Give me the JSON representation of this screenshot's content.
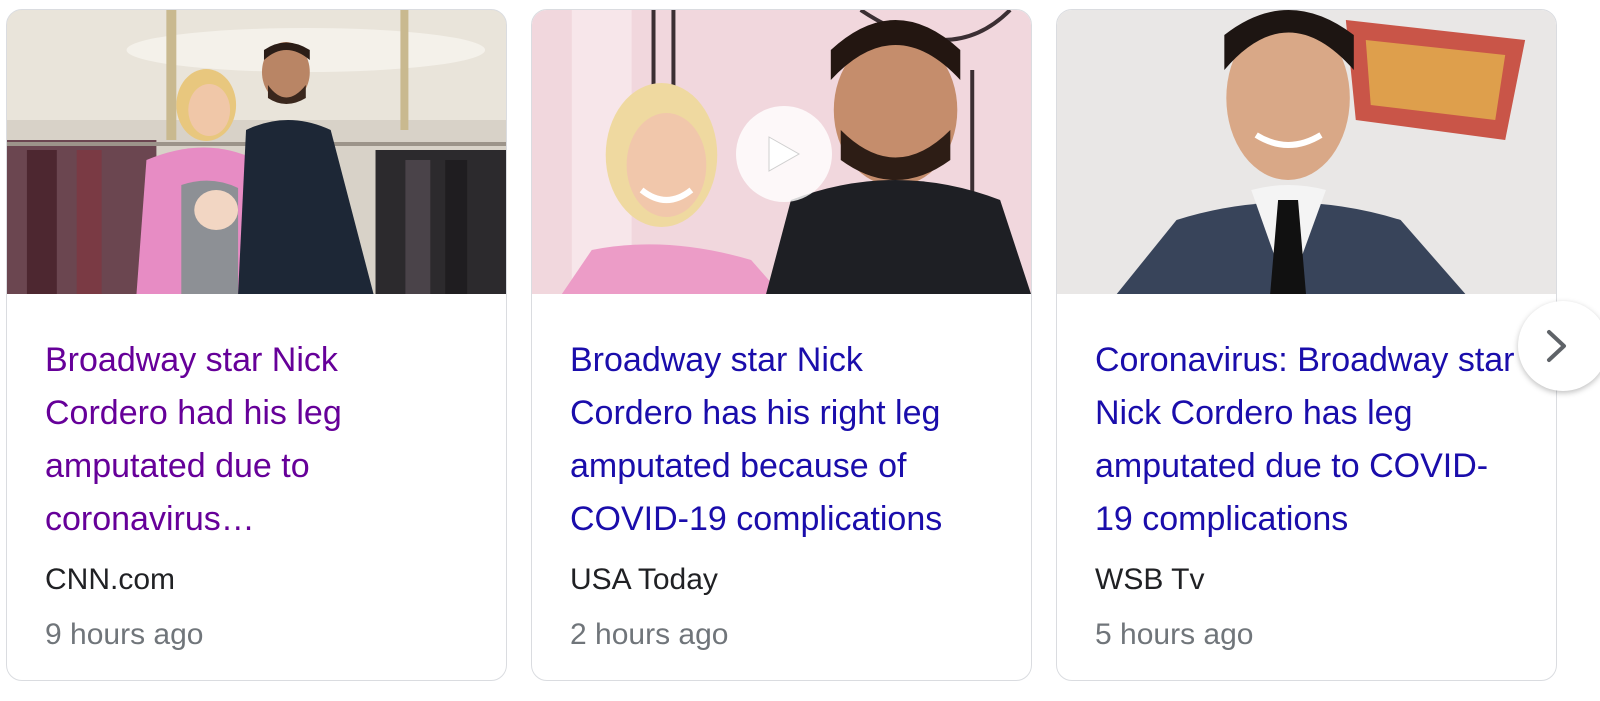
{
  "colors": {
    "link": "#1a0dab",
    "visited": "#660099",
    "source": "#202124",
    "time": "#70757a",
    "border": "#dadce0"
  },
  "cards": [
    {
      "headline": "Broadway star Nick Cordero had his leg amputated due to coronavirus…",
      "visited": true,
      "source": "CNN.com",
      "time": "9 hours ago",
      "has_video": false
    },
    {
      "headline": "Broadway star Nick Cordero has his right leg amputated because of COVID-19 complications",
      "visited": false,
      "source": "USA Today",
      "time": "2 hours ago",
      "has_video": true
    },
    {
      "headline": "Coronavirus: Broadway star Nick Cordero has leg amputated due to COVID-19 complications",
      "visited": false,
      "source": "WSB Tv",
      "time": "5 hours ago",
      "has_video": false
    }
  ],
  "icons": {
    "play": "play-icon",
    "next": "chevron-right-icon"
  }
}
